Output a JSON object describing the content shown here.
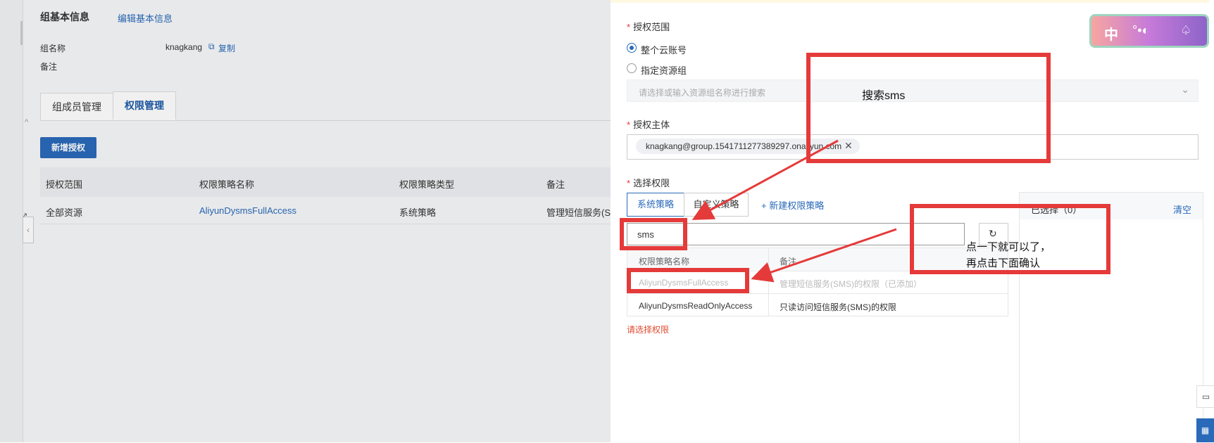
{
  "left": {
    "section_title": "组基本信息",
    "edit_link": "编辑基本信息",
    "group_name_label": "组名称",
    "group_name_value": "knagkang",
    "copy_link": "复制",
    "remark_label": "备注",
    "tabs": [
      "组成员管理",
      "权限管理"
    ],
    "add_button": "新增授权",
    "table": {
      "headers": [
        "授权范围",
        "权限策略名称",
        "权限策略类型",
        "备注"
      ],
      "row": [
        "全部资源",
        "AliyunDysmsFullAccess",
        "系统策略",
        "管理短信服务(SMS"
      ]
    }
  },
  "panel": {
    "scope_label": "授权范围",
    "scope_options": [
      "整个云账号",
      "指定资源组"
    ],
    "resource_placeholder": "请选择或输入资源组名称进行搜索",
    "principal_label": "授权主体",
    "principal_tag": "knagkang@group.1541711277389297.onaliyun.com",
    "perm_label": "选择权限",
    "perm_tabs": [
      "系统策略",
      "自定义策略"
    ],
    "new_policy": "新建权限策略",
    "search_value": "sms",
    "selected_header": "已选择（0）",
    "clear_link": "清空",
    "list_headers": [
      "权限策略名称",
      "备注"
    ],
    "rows": [
      {
        "name": "AliyunDysmsFullAccess",
        "remark": "管理短信服务(SMS)的权限（已添加）"
      },
      {
        "name": "AliyunDysmsReadOnlyAccess",
        "remark": "只读访问短信服务(SMS)的权限"
      }
    ],
    "error_text": "请选择权限"
  },
  "annotations": {
    "search_note": "搜索sms",
    "click_note_line1": "点一下就可以了，",
    "click_note_line2": "再点击下面确认"
  },
  "widget": {
    "badge_text": "中"
  },
  "colors": {
    "accent": "#2a6ab9",
    "annotation_red": "#e53a3a"
  }
}
